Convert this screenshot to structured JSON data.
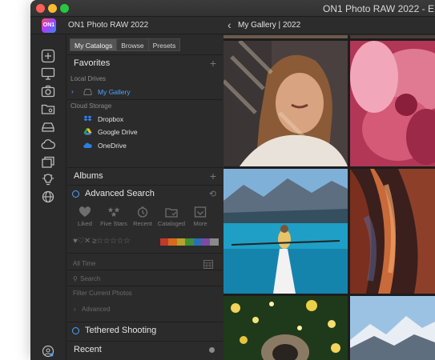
{
  "window": {
    "title": "ON1 Photo RAW 2022 - E",
    "app_name": "ON1 Photo RAW 2022",
    "logo_text": "ON1"
  },
  "toolbar": {
    "breadcrumb": "My Gallery | 2022"
  },
  "rail_icons": [
    "add-icon",
    "monitor-icon",
    "camera-icon",
    "folder-icon",
    "drive-icon",
    "cloud-icon",
    "stack-icon",
    "bulb-icon",
    "sphere-icon",
    "user-circle-icon"
  ],
  "sidebar": {
    "tabs": [
      {
        "label": "My Catalogs",
        "active": true
      },
      {
        "label": "Browse",
        "active": false
      },
      {
        "label": "Presets",
        "active": false
      }
    ],
    "favorites": {
      "title": "Favorites",
      "local_drives_label": "Local Drives",
      "my_gallery": "My Gallery",
      "cloud_storage_label": "Cloud Storage",
      "cloud_items": [
        "Dropbox",
        "Google Drive",
        "OneDrive"
      ]
    },
    "albums": {
      "title": "Albums"
    },
    "advanced_search": {
      "title": "Advanced Search",
      "filters": [
        "Liked",
        "Five Stars",
        "Recent",
        "Cataloged",
        "More"
      ],
      "rating_glyphs": "♥♡✕ ≥☆☆☆☆☆",
      "color_labels": [
        "#c0392b",
        "#d46a1c",
        "#b7a22a",
        "#3e8f3a",
        "#2a6fb0",
        "#7d4aa8",
        "#8a8a8a"
      ],
      "date_value": "All Time",
      "search_placeholder": "Search",
      "filter_current": "Filter Current Photos",
      "advanced_label": "Advanced"
    },
    "tethered": {
      "title": "Tethered Shooting"
    },
    "recent": {
      "title": "Recent"
    }
  },
  "colors": {
    "accent": "#4da3ff",
    "window_bg": "#2a2a2a"
  }
}
